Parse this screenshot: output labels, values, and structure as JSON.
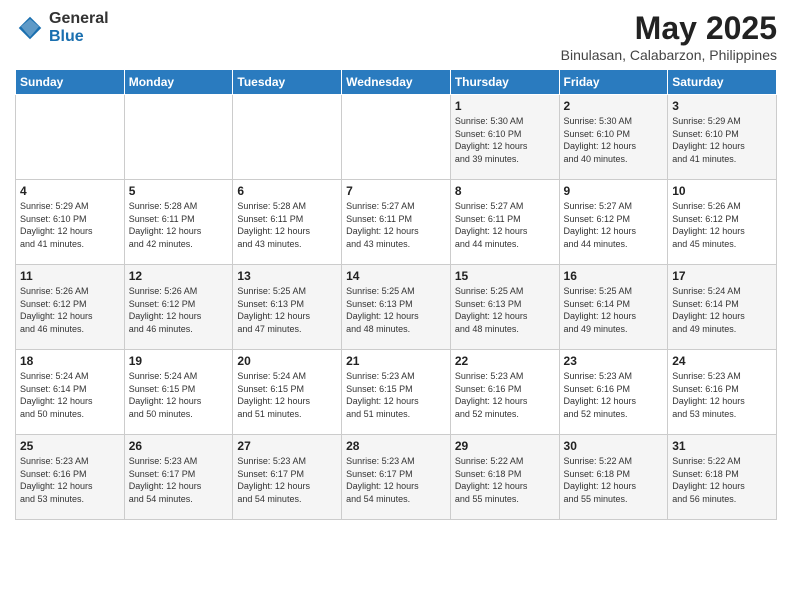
{
  "header": {
    "logo_general": "General",
    "logo_blue": "Blue",
    "month_year": "May 2025",
    "location": "Binulasan, Calabarzon, Philippines"
  },
  "weekdays": [
    "Sunday",
    "Monday",
    "Tuesday",
    "Wednesday",
    "Thursday",
    "Friday",
    "Saturday"
  ],
  "weeks": [
    [
      {
        "day": "",
        "content": ""
      },
      {
        "day": "",
        "content": ""
      },
      {
        "day": "",
        "content": ""
      },
      {
        "day": "",
        "content": ""
      },
      {
        "day": "1",
        "content": "Sunrise: 5:30 AM\nSunset: 6:10 PM\nDaylight: 12 hours\nand 39 minutes."
      },
      {
        "day": "2",
        "content": "Sunrise: 5:30 AM\nSunset: 6:10 PM\nDaylight: 12 hours\nand 40 minutes."
      },
      {
        "day": "3",
        "content": "Sunrise: 5:29 AM\nSunset: 6:10 PM\nDaylight: 12 hours\nand 41 minutes."
      }
    ],
    [
      {
        "day": "4",
        "content": "Sunrise: 5:29 AM\nSunset: 6:10 PM\nDaylight: 12 hours\nand 41 minutes."
      },
      {
        "day": "5",
        "content": "Sunrise: 5:28 AM\nSunset: 6:11 PM\nDaylight: 12 hours\nand 42 minutes."
      },
      {
        "day": "6",
        "content": "Sunrise: 5:28 AM\nSunset: 6:11 PM\nDaylight: 12 hours\nand 43 minutes."
      },
      {
        "day": "7",
        "content": "Sunrise: 5:27 AM\nSunset: 6:11 PM\nDaylight: 12 hours\nand 43 minutes."
      },
      {
        "day": "8",
        "content": "Sunrise: 5:27 AM\nSunset: 6:11 PM\nDaylight: 12 hours\nand 44 minutes."
      },
      {
        "day": "9",
        "content": "Sunrise: 5:27 AM\nSunset: 6:12 PM\nDaylight: 12 hours\nand 44 minutes."
      },
      {
        "day": "10",
        "content": "Sunrise: 5:26 AM\nSunset: 6:12 PM\nDaylight: 12 hours\nand 45 minutes."
      }
    ],
    [
      {
        "day": "11",
        "content": "Sunrise: 5:26 AM\nSunset: 6:12 PM\nDaylight: 12 hours\nand 46 minutes."
      },
      {
        "day": "12",
        "content": "Sunrise: 5:26 AM\nSunset: 6:12 PM\nDaylight: 12 hours\nand 46 minutes."
      },
      {
        "day": "13",
        "content": "Sunrise: 5:25 AM\nSunset: 6:13 PM\nDaylight: 12 hours\nand 47 minutes."
      },
      {
        "day": "14",
        "content": "Sunrise: 5:25 AM\nSunset: 6:13 PM\nDaylight: 12 hours\nand 48 minutes."
      },
      {
        "day": "15",
        "content": "Sunrise: 5:25 AM\nSunset: 6:13 PM\nDaylight: 12 hours\nand 48 minutes."
      },
      {
        "day": "16",
        "content": "Sunrise: 5:25 AM\nSunset: 6:14 PM\nDaylight: 12 hours\nand 49 minutes."
      },
      {
        "day": "17",
        "content": "Sunrise: 5:24 AM\nSunset: 6:14 PM\nDaylight: 12 hours\nand 49 minutes."
      }
    ],
    [
      {
        "day": "18",
        "content": "Sunrise: 5:24 AM\nSunset: 6:14 PM\nDaylight: 12 hours\nand 50 minutes."
      },
      {
        "day": "19",
        "content": "Sunrise: 5:24 AM\nSunset: 6:15 PM\nDaylight: 12 hours\nand 50 minutes."
      },
      {
        "day": "20",
        "content": "Sunrise: 5:24 AM\nSunset: 6:15 PM\nDaylight: 12 hours\nand 51 minutes."
      },
      {
        "day": "21",
        "content": "Sunrise: 5:23 AM\nSunset: 6:15 PM\nDaylight: 12 hours\nand 51 minutes."
      },
      {
        "day": "22",
        "content": "Sunrise: 5:23 AM\nSunset: 6:16 PM\nDaylight: 12 hours\nand 52 minutes."
      },
      {
        "day": "23",
        "content": "Sunrise: 5:23 AM\nSunset: 6:16 PM\nDaylight: 12 hours\nand 52 minutes."
      },
      {
        "day": "24",
        "content": "Sunrise: 5:23 AM\nSunset: 6:16 PM\nDaylight: 12 hours\nand 53 minutes."
      }
    ],
    [
      {
        "day": "25",
        "content": "Sunrise: 5:23 AM\nSunset: 6:16 PM\nDaylight: 12 hours\nand 53 minutes."
      },
      {
        "day": "26",
        "content": "Sunrise: 5:23 AM\nSunset: 6:17 PM\nDaylight: 12 hours\nand 54 minutes."
      },
      {
        "day": "27",
        "content": "Sunrise: 5:23 AM\nSunset: 6:17 PM\nDaylight: 12 hours\nand 54 minutes."
      },
      {
        "day": "28",
        "content": "Sunrise: 5:23 AM\nSunset: 6:17 PM\nDaylight: 12 hours\nand 54 minutes."
      },
      {
        "day": "29",
        "content": "Sunrise: 5:22 AM\nSunset: 6:18 PM\nDaylight: 12 hours\nand 55 minutes."
      },
      {
        "day": "30",
        "content": "Sunrise: 5:22 AM\nSunset: 6:18 PM\nDaylight: 12 hours\nand 55 minutes."
      },
      {
        "day": "31",
        "content": "Sunrise: 5:22 AM\nSunset: 6:18 PM\nDaylight: 12 hours\nand 56 minutes."
      }
    ]
  ]
}
